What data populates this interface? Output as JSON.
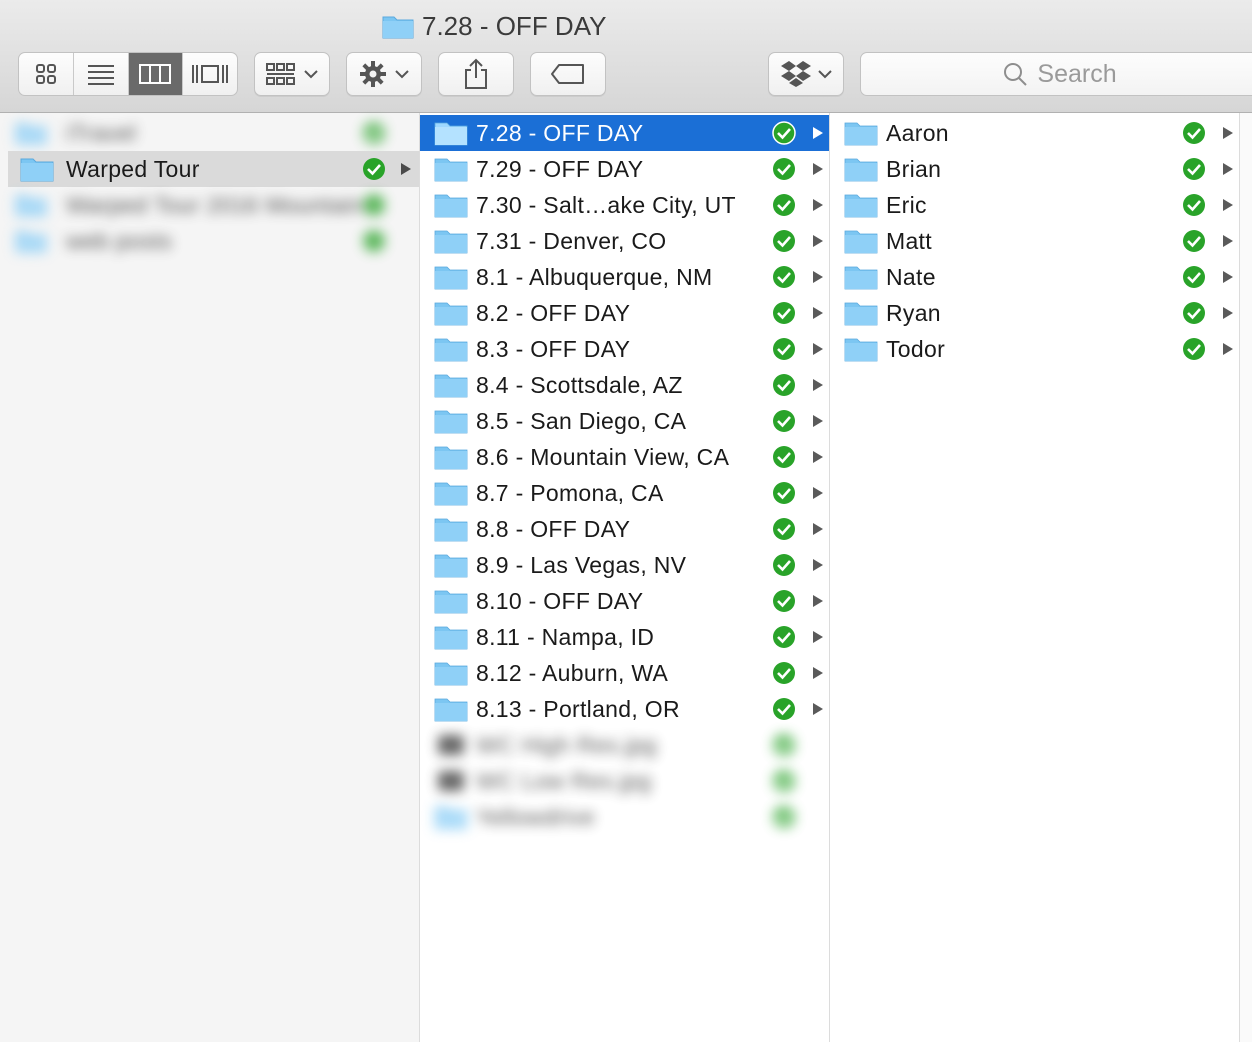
{
  "window": {
    "title": "7.28 - OFF DAY"
  },
  "toolbar": {
    "view_modes": [
      "icon-view",
      "list-view",
      "column-view",
      "cover-flow-view"
    ],
    "active_view": "column-view",
    "group_by": "group-by",
    "action": "action",
    "share": "share",
    "tags": "tags",
    "dropbox": "dropbox",
    "search_placeholder": "Search"
  },
  "column1": {
    "items": [
      {
        "label": "iTravel"
      },
      {
        "label": "Warped Tour"
      },
      {
        "label": "Warped Tour 2016 Mountain"
      },
      {
        "label": "web posts"
      }
    ]
  },
  "column2": {
    "items": [
      {
        "label": "7.28 - OFF DAY"
      },
      {
        "label": "7.29 - OFF DAY"
      },
      {
        "label": "7.30 - Salt…ake City, UT"
      },
      {
        "label": "7.31 - Denver, CO"
      },
      {
        "label": "8.1 - Albuquerque, NM"
      },
      {
        "label": "8.2 - OFF DAY"
      },
      {
        "label": "8.3 - OFF DAY"
      },
      {
        "label": "8.4 - Scottsdale, AZ"
      },
      {
        "label": "8.5 - San Diego, CA"
      },
      {
        "label": "8.6 - Mountain View, CA"
      },
      {
        "label": "8.7 - Pomona, CA"
      },
      {
        "label": "8.8 - OFF DAY"
      },
      {
        "label": "8.9 - Las Vegas, NV"
      },
      {
        "label": "8.10 - OFF DAY"
      },
      {
        "label": "8.11 - Nampa, ID"
      },
      {
        "label": "8.12 - Auburn, WA"
      },
      {
        "label": "8.13 - Portland, OR"
      }
    ],
    "blurred_items": [
      {
        "label": "WC High Res.jpg"
      },
      {
        "label": "WC Low Res.jpg"
      },
      {
        "label": "Yellowdrive"
      }
    ]
  },
  "column3": {
    "items": [
      {
        "label": "Aaron"
      },
      {
        "label": "Brian"
      },
      {
        "label": "Eric"
      },
      {
        "label": "Matt"
      },
      {
        "label": "Nate"
      },
      {
        "label": "Ryan"
      },
      {
        "label": "Todor"
      }
    ]
  },
  "colors": {
    "selection": "#1b6fd6",
    "sync_ok": "#29a329",
    "folder": "#7cc6f2"
  }
}
